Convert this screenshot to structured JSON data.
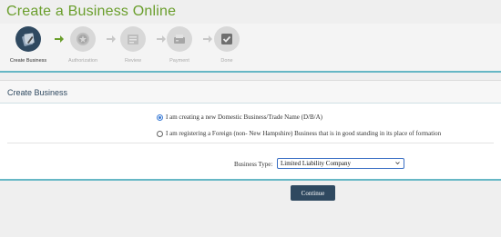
{
  "page": {
    "title": "Create a Business Online"
  },
  "wizard": {
    "steps": [
      {
        "label": "Create Business",
        "icon": "create-business-icon",
        "state": "active"
      },
      {
        "label": "Authorization",
        "icon": "authorization-icon",
        "state": "inactive"
      },
      {
        "label": "Review",
        "icon": "review-icon",
        "state": "inactive"
      },
      {
        "label": "Payment",
        "icon": "payment-icon",
        "state": "inactive"
      },
      {
        "label": "Done",
        "icon": "done-icon",
        "state": "inactive"
      }
    ],
    "colors": {
      "active": "#2f4960",
      "inactive": "#d8d8d8",
      "arrow_active": "#6a9e2c",
      "arrow_inactive": "#c8c8c8"
    }
  },
  "panel": {
    "title": "Create Business",
    "options": [
      {
        "label": "I am creating a new Domestic Business/Trade Name (D/B/A)",
        "checked": true
      },
      {
        "label": "I am registering a Foreign (non- New Hampshire) Business that is in good standing in its place of formation",
        "checked": false
      }
    ],
    "business_type": {
      "label": "Business Type:",
      "selected": "Limited Liability Company"
    }
  },
  "actions": {
    "continue_label": "Continue"
  }
}
